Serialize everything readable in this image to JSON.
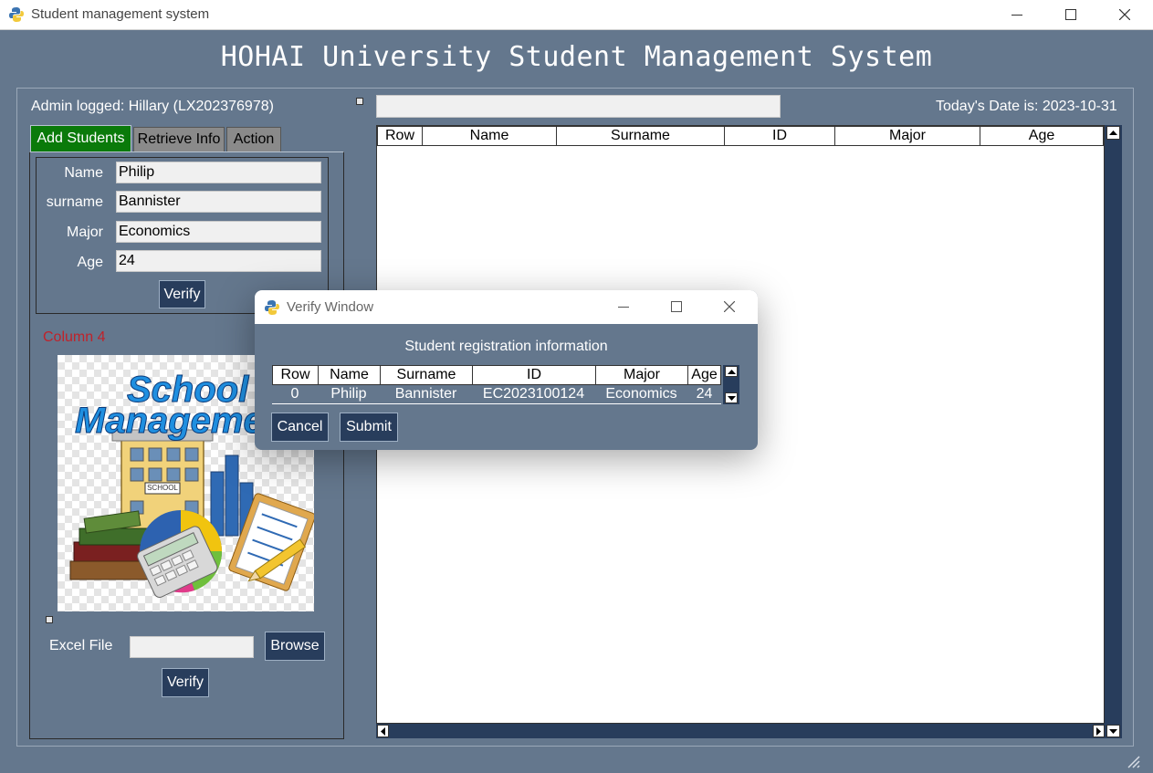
{
  "window": {
    "title": "Student management system",
    "app_heading": "HOHAI University Student Management System"
  },
  "header": {
    "admin_text": "Admin logged: Hillary (LX202376978)",
    "date_text": "Today's Date is: 2023-10-31",
    "search_value": ""
  },
  "tabs": [
    {
      "label": "Add Students",
      "active": true
    },
    {
      "label": "Retrieve Info",
      "active": false
    },
    {
      "label": "Action",
      "active": false
    }
  ],
  "form": {
    "fields": [
      {
        "label": "Name",
        "value": "Philip"
      },
      {
        "label": "surname",
        "value": "Bannister"
      },
      {
        "label": "Major",
        "value": "Economics"
      },
      {
        "label": "Age",
        "value": "24"
      }
    ],
    "verify_label": "Verify"
  },
  "column4": {
    "label": "Column 4",
    "image_text": [
      "School",
      "Management"
    ],
    "building_sign": "SCHOOL"
  },
  "excel": {
    "label": "Excel File",
    "value": "",
    "browse_label": "Browse",
    "verify_label": "Verify"
  },
  "table": {
    "columns": [
      "Row",
      "Name",
      "Surname",
      "ID",
      "Major",
      "Age"
    ],
    "rows": []
  },
  "dialog": {
    "title": "Verify Window",
    "heading": "Student registration information",
    "columns": [
      "Row",
      "Name",
      "Surname",
      "ID",
      "Major",
      "Age"
    ],
    "rows": [
      [
        "0",
        "Philip",
        "Bannister",
        "EC2023100124",
        "Economics",
        "24"
      ]
    ],
    "cancel_label": "Cancel",
    "submit_label": "Submit"
  },
  "colors": {
    "background": "#64778d",
    "button": "#283d5c",
    "active_tab": "#0a7a0a",
    "inactive_tab": "#8a8a8a",
    "column_label": "#c0222a"
  },
  "icons": [
    "python-icon",
    "minimize-icon",
    "maximize-icon",
    "close-icon",
    "resize-grip-icon"
  ]
}
